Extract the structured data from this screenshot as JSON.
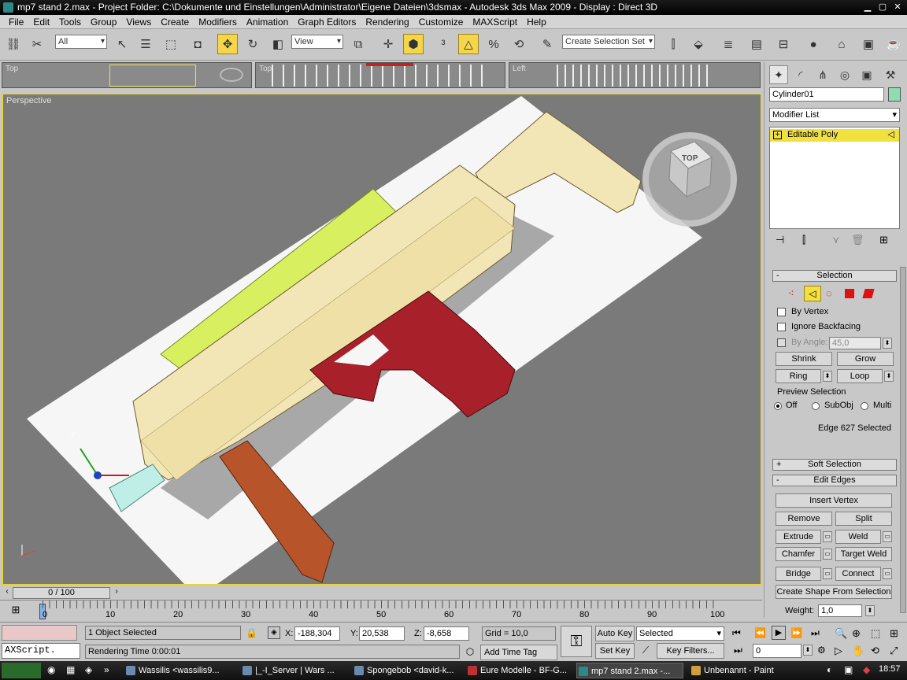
{
  "window": {
    "title": "mp7 stand 2.max     - Project Folder: C:\\Dokumente und Einstellungen\\Administrator\\Eigene Dateien\\3dsmax     - Autodesk 3ds Max  2009          - Display : Direct 3D"
  },
  "menu": [
    "File",
    "Edit",
    "Tools",
    "Group",
    "Views",
    "Create",
    "Modifiers",
    "Animation",
    "Graph Editors",
    "Rendering",
    "Customize",
    "MAXScript",
    "Help"
  ],
  "toolbar": {
    "selection_filter": "All",
    "reference_coord": "View",
    "named_selection_placeholder": "Create Selection Set"
  },
  "viewports": {
    "top": "Top",
    "front": "Top",
    "left": "Left",
    "perspective": "Perspective",
    "viewcube_face": "TOP"
  },
  "command_panel": {
    "object_name": "Cylinder01",
    "object_color": "#8fdcb0",
    "modifier_list": "Modifier List",
    "stack_item": "Editable Poly",
    "selection": {
      "header": "Selection",
      "by_vertex": "By Vertex",
      "ignore_backfacing": "Ignore Backfacing",
      "by_angle": "By Angle:",
      "angle_value": "45,0",
      "shrink": "Shrink",
      "grow": "Grow",
      "ring": "Ring",
      "loop": "Loop",
      "preview_selection": "Preview Selection",
      "preview_off": "Off",
      "preview_subobj": "SubObj",
      "preview_multi": "Multi",
      "status": "Edge 627 Selected"
    },
    "soft_selection": "Soft Selection",
    "edit_edges": {
      "header": "Edit Edges",
      "insert_vertex": "Insert Vertex",
      "remove": "Remove",
      "split": "Split",
      "extrude": "Extrude",
      "weld": "Weld",
      "chamfer": "Chamfer",
      "target_weld": "Target Weld",
      "bridge": "Bridge",
      "connect": "Connect",
      "create_shape": "Create Shape From Selection",
      "weight_label": "Weight:",
      "weight_value": "1,0"
    }
  },
  "timeline": {
    "frame": "0 / 100",
    "ticks": [
      "0",
      "10",
      "20",
      "30",
      "40",
      "50",
      "60",
      "70",
      "80",
      "90",
      "100"
    ]
  },
  "status": {
    "maxscript": "AXScript.",
    "selected": "1 Object Selected",
    "rendering_time": "Rendering Time  0:00:01",
    "x_label": "X:",
    "x_value": "-188,304",
    "y_label": "Y:",
    "y_value": "20,538",
    "z_label": "Z:",
    "z_value": "-8,658",
    "grid": "Grid = 10,0",
    "add_time_tag": "Add Time Tag",
    "auto_key": "Auto Key",
    "set_key": "Set Key",
    "key_mode": "Selected",
    "key_filters": "Key Filters...",
    "current_frame": "0"
  },
  "taskbar": {
    "clock": "18:57",
    "tasks": [
      "Wassilis <wassilis9...",
      "|_-I_Server | Wars ...",
      "Spongebob <david-k...",
      "Eure Modelle - BF-G...",
      "mp7 stand 2.max    -...",
      "Unbenannt - Paint"
    ]
  },
  "colors": {
    "gun_body": "#f3e6b6",
    "grip": "#a8202a",
    "magazine": "#b8542a",
    "rail": "#d8f060",
    "ground_plane": "#f4f4f4",
    "viewport_bg": "#7a7a7a",
    "active_border": "#e8d23a"
  }
}
